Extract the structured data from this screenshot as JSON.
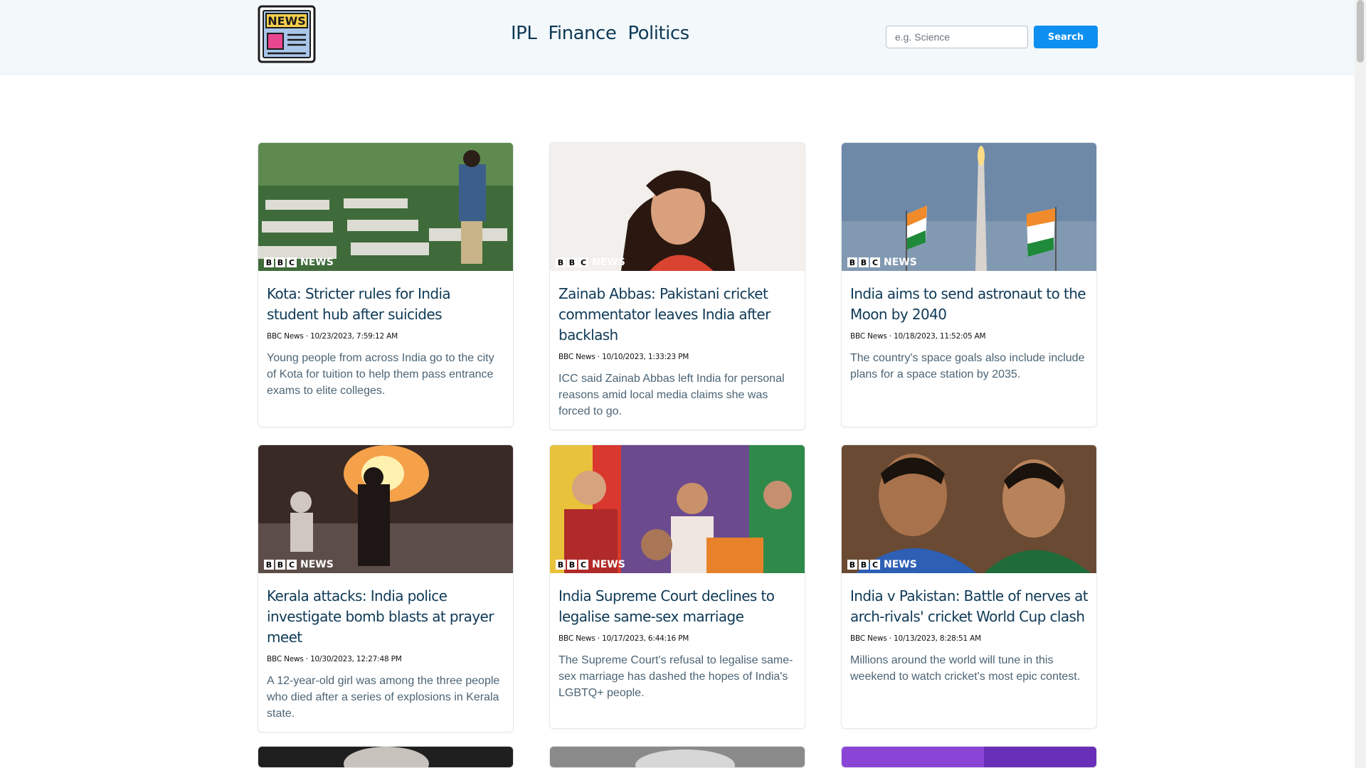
{
  "header": {
    "logo_text": "NEWS",
    "nav": [
      "IPL",
      "Finance",
      "Politics"
    ],
    "search_placeholder": "e.g. Science",
    "search_button": "Search"
  },
  "brand_overlay": {
    "letters": [
      "B",
      "B",
      "C"
    ],
    "word": "NEWS"
  },
  "articles": [
    {
      "title": "Kota: Stricter rules for India student hub after suicides",
      "meta": "BBC News · 10/23/2023, 7:59:12 AM",
      "description": "Young people from across India go to the city of Kota for tuition to help them pass entrance exams to elite colleges."
    },
    {
      "title": "Zainab Abbas: Pakistani cricket commentator leaves India after backlash",
      "meta": "BBC News · 10/10/2023, 1:33:23 PM",
      "description": "ICC said Zainab Abbas left India for personal reasons amid local media claims she was forced to go."
    },
    {
      "title": "India aims to send astronaut to the Moon by 2040",
      "meta": "BBC News · 10/18/2023, 11:52:05 AM",
      "description": "The country's space goals also include include plans for a space station by 2035."
    },
    {
      "title": "Kerala attacks: India police investigate bomb blasts at prayer meet",
      "meta": "BBC News · 10/30/2023, 12:27:48 PM",
      "description": "A 12-year-old girl was among the three people who died after a series of explosions in Kerala state."
    },
    {
      "title": "India Supreme Court declines to legalise same-sex marriage",
      "meta": "BBC News · 10/17/2023, 6:44:16 PM",
      "description": "The Supreme Court's refusal to legalise same-sex marriage has dashed the hopes of India's LGBTQ+ people."
    },
    {
      "title": "India v Pakistan: Battle of nerves at arch-rivals' cricket World Cup clash",
      "meta": "BBC News · 10/13/2023, 8:28:51 AM",
      "description": "Millions around the world will tune in this weekend to watch cricket's most epic contest."
    }
  ],
  "colors": {
    "accent": "#0d8ff0",
    "title": "#0f3a57",
    "header_bg": "#f3f8fb",
    "desc": "#4c6475"
  }
}
